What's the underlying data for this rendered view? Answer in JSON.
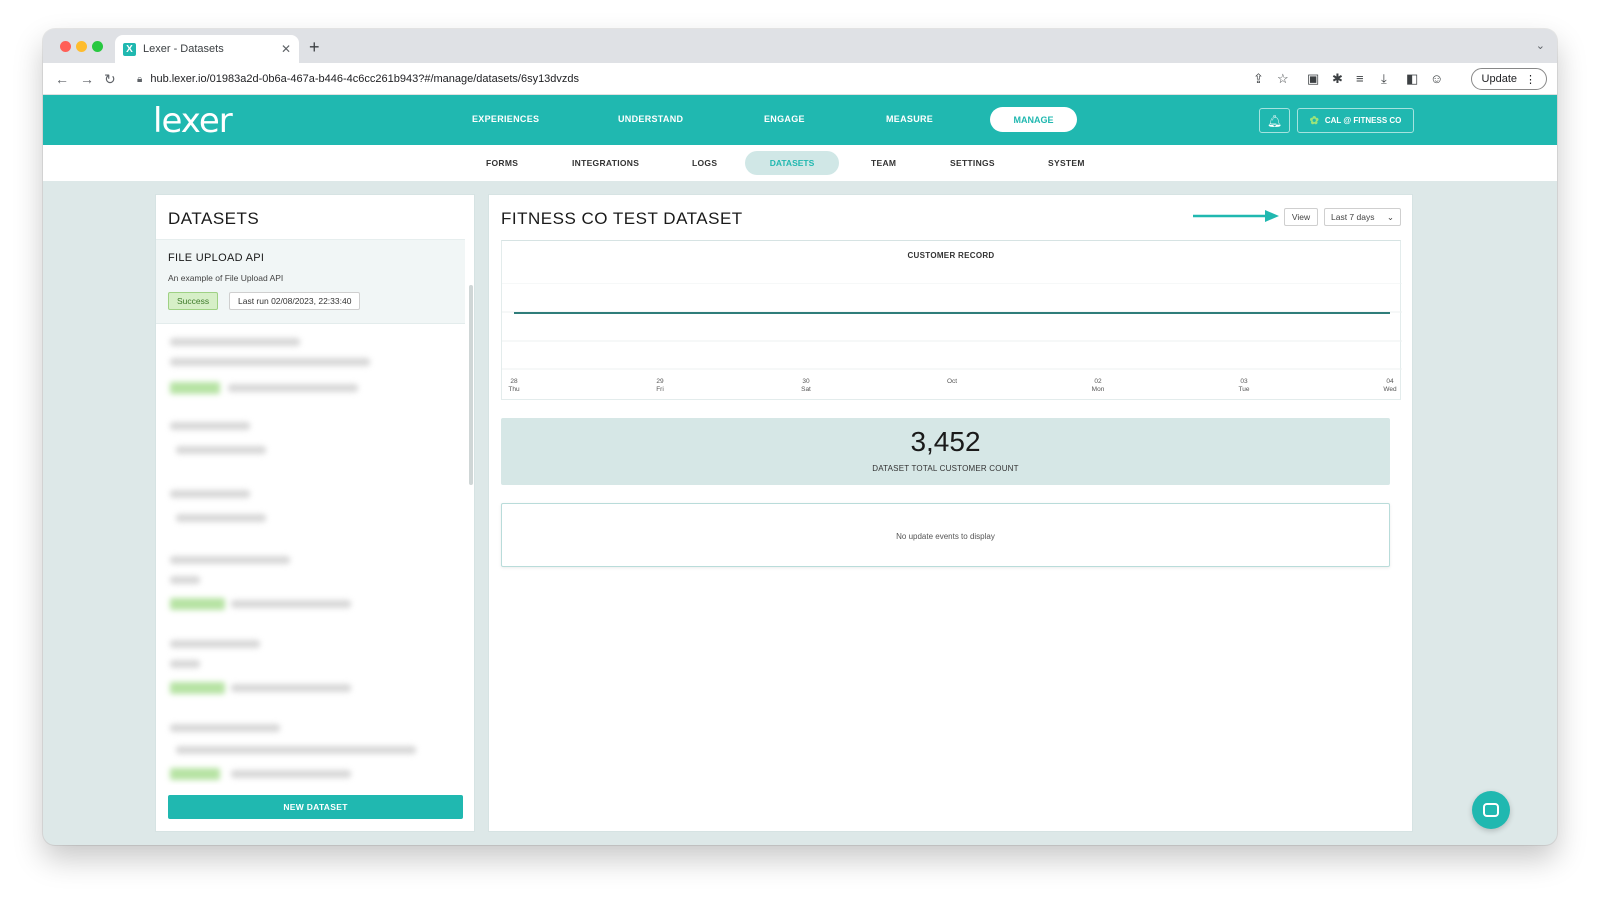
{
  "browser": {
    "tab_title": "Lexer - Datasets",
    "url": "hub.lexer.io/01983a2d-0b6a-467a-b446-4c6cc261b943?#/manage/datasets/6sy13dvzds",
    "update_label": "Update"
  },
  "app": {
    "logo": "lexer",
    "main_nav": [
      "EXPERIENCES",
      "UNDERSTAND",
      "ENGAGE",
      "MEASURE"
    ],
    "main_nav_active": "MANAGE",
    "account": "CAL @ FITNESS CO"
  },
  "sub_nav": {
    "items": [
      "FORMS",
      "INTEGRATIONS",
      "LOGS",
      "TEAM",
      "SETTINGS",
      "SYSTEM"
    ],
    "active": "DATASETS"
  },
  "datasets_panel": {
    "title": "DATASETS",
    "selected": {
      "title": "FILE UPLOAD API",
      "description": "An example of File Upload API",
      "status": "Success",
      "last_run": "Last run 02/08/2023, 22:33:40"
    },
    "new_button": "NEW DATASET"
  },
  "dataset_detail": {
    "title": "FITNESS CO TEST DATASET",
    "view_label": "View",
    "range_label": "Last 7 days",
    "chart_title": "CUSTOMER RECORD",
    "total_value": "3,452",
    "total_label": "DATASET TOTAL CUSTOMER COUNT",
    "events_empty": "No update events to display"
  },
  "chart_data": {
    "type": "line",
    "title": "CUSTOMER RECORD",
    "categories": [
      {
        "day": "28",
        "wd": "Thu"
      },
      {
        "day": "29",
        "wd": "Fri"
      },
      {
        "day": "30",
        "wd": "Sat"
      },
      {
        "day": "Oct",
        "wd": ""
      },
      {
        "day": "02",
        "wd": "Mon"
      },
      {
        "day": "03",
        "wd": "Tue"
      },
      {
        "day": "04",
        "wd": "Wed"
      }
    ],
    "series": [
      {
        "values": [
          3452,
          3452,
          3452,
          3452,
          3452,
          3452,
          3452
        ]
      }
    ],
    "line_color": "#2f7d7a"
  },
  "colors": {
    "brand": "#20b8b0",
    "page_bg": "#dde8e8"
  }
}
